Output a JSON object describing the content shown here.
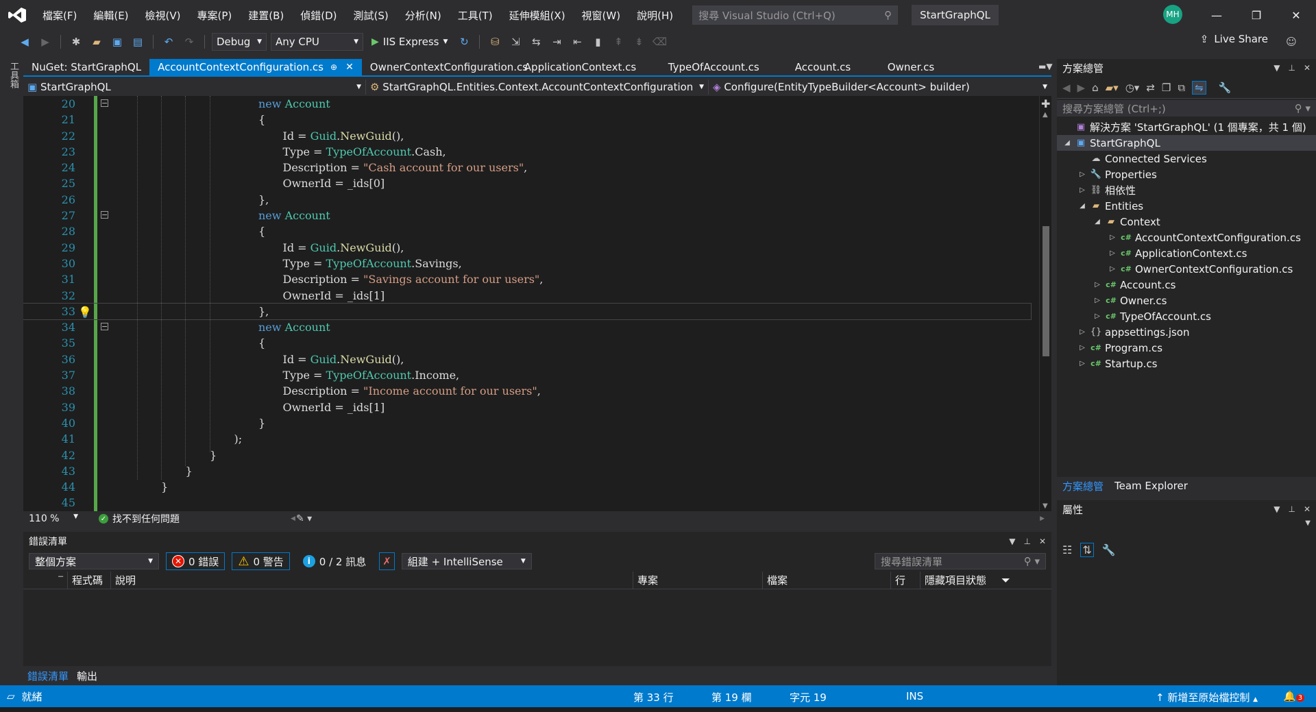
{
  "menu": [
    "檔案(F)",
    "編輯(E)",
    "檢視(V)",
    "專案(P)",
    "建置(B)",
    "偵錯(D)",
    "測試(S)",
    "分析(N)",
    "工具(T)",
    "延伸模組(X)",
    "視窗(W)",
    "說明(H)"
  ],
  "search": {
    "placeholder": "搜尋 Visual Studio (Ctrl+Q)"
  },
  "project_title": "StartGraphQL",
  "user_initials": "MH",
  "toolbar": {
    "config": "Debug",
    "platform": "Any CPU",
    "run_target": "IIS Express",
    "live_share": "Live Share"
  },
  "toolbox_label": "工具箱",
  "tabs": [
    {
      "label": "NuGet: StartGraphQL",
      "active": false
    },
    {
      "label": "AccountContextConfiguration.cs",
      "active": true
    },
    {
      "label": "OwnerContextConfiguration.cs",
      "active": false
    },
    {
      "label": "ApplicationContext.cs",
      "active": false
    },
    {
      "label": "TypeOfAccount.cs",
      "active": false
    },
    {
      "label": "Account.cs",
      "active": false
    },
    {
      "label": "Owner.cs",
      "active": false
    }
  ],
  "navbar": {
    "project": "StartGraphQL",
    "class": "StartGraphQL.Entities.Context.AccountContextConfiguration",
    "member": "Configure(EntityTypeBuilder<Account> builder)"
  },
  "code": {
    "current_line": 33,
    "lines": [
      {
        "n": "20",
        "indent": 6,
        "tokens": [
          [
            "kw",
            "new "
          ],
          [
            "ty",
            "Account"
          ]
        ],
        "fold": true
      },
      {
        "n": "21",
        "indent": 6,
        "tokens": [
          [
            "p",
            "{"
          ]
        ]
      },
      {
        "n": "22",
        "indent": 7,
        "tokens": [
          [
            "p",
            "Id = "
          ],
          [
            "ty",
            "Guid"
          ],
          [
            "p",
            "."
          ],
          [
            "mth",
            "NewGuid"
          ],
          [
            "p",
            "(),"
          ]
        ]
      },
      {
        "n": "23",
        "indent": 7,
        "tokens": [
          [
            "p",
            "Type = "
          ],
          [
            "ty",
            "TypeOfAccount"
          ],
          [
            "p",
            ".Cash,"
          ]
        ]
      },
      {
        "n": "24",
        "indent": 7,
        "tokens": [
          [
            "p",
            "Description = "
          ],
          [
            "str",
            "\"Cash account for our users\""
          ],
          [
            "p",
            ","
          ]
        ]
      },
      {
        "n": "25",
        "indent": 7,
        "tokens": [
          [
            "p",
            "OwnerId = _ids[0]"
          ]
        ]
      },
      {
        "n": "26",
        "indent": 6,
        "tokens": [
          [
            "p",
            "},"
          ]
        ]
      },
      {
        "n": "27",
        "indent": 6,
        "tokens": [
          [
            "kw",
            "new "
          ],
          [
            "ty",
            "Account"
          ]
        ],
        "fold": true
      },
      {
        "n": "28",
        "indent": 6,
        "tokens": [
          [
            "p",
            "{"
          ]
        ]
      },
      {
        "n": "29",
        "indent": 7,
        "tokens": [
          [
            "p",
            "Id = "
          ],
          [
            "ty",
            "Guid"
          ],
          [
            "p",
            "."
          ],
          [
            "mth",
            "NewGuid"
          ],
          [
            "p",
            "(),"
          ]
        ]
      },
      {
        "n": "30",
        "indent": 7,
        "tokens": [
          [
            "p",
            "Type = "
          ],
          [
            "ty",
            "TypeOfAccount"
          ],
          [
            "p",
            ".Savings,"
          ]
        ]
      },
      {
        "n": "31",
        "indent": 7,
        "tokens": [
          [
            "p",
            "Description = "
          ],
          [
            "str",
            "\"Savings account for our users\""
          ],
          [
            "p",
            ","
          ]
        ]
      },
      {
        "n": "32",
        "indent": 7,
        "tokens": [
          [
            "p",
            "OwnerId = _ids[1]"
          ]
        ]
      },
      {
        "n": "33",
        "indent": 6,
        "tokens": [
          [
            "p",
            "},"
          ]
        ],
        "bulb": true
      },
      {
        "n": "34",
        "indent": 6,
        "tokens": [
          [
            "kw",
            "new "
          ],
          [
            "ty",
            "Account"
          ]
        ],
        "fold": true
      },
      {
        "n": "35",
        "indent": 6,
        "tokens": [
          [
            "p",
            "{"
          ]
        ]
      },
      {
        "n": "36",
        "indent": 7,
        "tokens": [
          [
            "p",
            "Id = "
          ],
          [
            "ty",
            "Guid"
          ],
          [
            "p",
            "."
          ],
          [
            "mth",
            "NewGuid"
          ],
          [
            "p",
            "(),"
          ]
        ]
      },
      {
        "n": "37",
        "indent": 7,
        "tokens": [
          [
            "p",
            "Type = "
          ],
          [
            "ty",
            "TypeOfAccount"
          ],
          [
            "p",
            ".Income,"
          ]
        ]
      },
      {
        "n": "38",
        "indent": 7,
        "tokens": [
          [
            "p",
            "Description = "
          ],
          [
            "str",
            "\"Income account for our users\""
          ],
          [
            "p",
            ","
          ]
        ]
      },
      {
        "n": "39",
        "indent": 7,
        "tokens": [
          [
            "p",
            "OwnerId = _ids[1]"
          ]
        ]
      },
      {
        "n": "40",
        "indent": 6,
        "tokens": [
          [
            "p",
            "}"
          ]
        ]
      },
      {
        "n": "41",
        "indent": 5,
        "tokens": [
          [
            "p",
            ");"
          ]
        ]
      },
      {
        "n": "42",
        "indent": 4,
        "tokens": [
          [
            "p",
            "}"
          ]
        ]
      },
      {
        "n": "43",
        "indent": 3,
        "tokens": [
          [
            "p",
            "}"
          ]
        ]
      },
      {
        "n": "44",
        "indent": 2,
        "tokens": [
          [
            "p",
            "}"
          ]
        ]
      },
      {
        "n": "45",
        "indent": 0,
        "tokens": []
      }
    ]
  },
  "editor_status": {
    "zoom": "110 %",
    "issues": "找不到任何問題"
  },
  "error_list": {
    "title": "錯誤清單",
    "scope": "整個方案",
    "errors": "0 錯誤",
    "warnings": "0 警告",
    "messages": "0 / 2 訊息",
    "build_filter": "組建 + IntelliSense",
    "search_placeholder": "搜尋錯誤清單",
    "columns": [
      "程式碼",
      "說明",
      "專案",
      "檔案",
      "行",
      "隱藏項目狀態"
    ]
  },
  "bottom_tabs": [
    "錯誤清單",
    "輸出"
  ],
  "solution_explorer": {
    "title": "方案總管",
    "search_placeholder": "搜尋方案總管 (Ctrl+;)",
    "items": [
      {
        "label": "解決方案 'StartGraphQL' (1 個專案，共 1 個)",
        "level": 0,
        "twisty": "",
        "icon": "solution"
      },
      {
        "label": "StartGraphQL",
        "level": 0,
        "twisty": "◢",
        "icon": "project",
        "selected": true
      },
      {
        "label": "Connected Services",
        "level": 1,
        "twisty": "",
        "icon": "cloud"
      },
      {
        "label": "Properties",
        "level": 1,
        "twisty": "▷",
        "icon": "wrench"
      },
      {
        "label": "相依性",
        "level": 1,
        "twisty": "▷",
        "icon": "deps"
      },
      {
        "label": "Entities",
        "level": 1,
        "twisty": "◢",
        "icon": "folder-open"
      },
      {
        "label": "Context",
        "level": 2,
        "twisty": "◢",
        "icon": "folder-open"
      },
      {
        "label": "AccountContextConfiguration.cs",
        "level": 3,
        "twisty": "▷",
        "icon": "cs"
      },
      {
        "label": "ApplicationContext.cs",
        "level": 3,
        "twisty": "▷",
        "icon": "cs"
      },
      {
        "label": "OwnerContextConfiguration.cs",
        "level": 3,
        "twisty": "▷",
        "icon": "cs"
      },
      {
        "label": "Account.cs",
        "level": 2,
        "twisty": "▷",
        "icon": "cs"
      },
      {
        "label": "Owner.cs",
        "level": 2,
        "twisty": "▷",
        "icon": "cs"
      },
      {
        "label": "TypeOfAccount.cs",
        "level": 2,
        "twisty": "▷",
        "icon": "cs"
      },
      {
        "label": "appsettings.json",
        "level": 1,
        "twisty": "▷",
        "icon": "json"
      },
      {
        "label": "Program.cs",
        "level": 1,
        "twisty": "▷",
        "icon": "cs"
      },
      {
        "label": "Startup.cs",
        "level": 1,
        "twisty": "▷",
        "icon": "cs"
      }
    ],
    "tabs": [
      "方案總管",
      "Team Explorer"
    ]
  },
  "properties": {
    "title": "屬性"
  },
  "status": {
    "ready": "就緒",
    "line": "第 33 行",
    "column": "第 19 欄",
    "char": "字元 19",
    "mode": "INS",
    "source_control": "新增至原始檔控制",
    "notifications": "3"
  },
  "colors": {
    "accent": "#007acc",
    "keyword": "#569cd6",
    "type": "#4ec9b0",
    "string": "#d69d85",
    "method": "#dcdcaa"
  }
}
